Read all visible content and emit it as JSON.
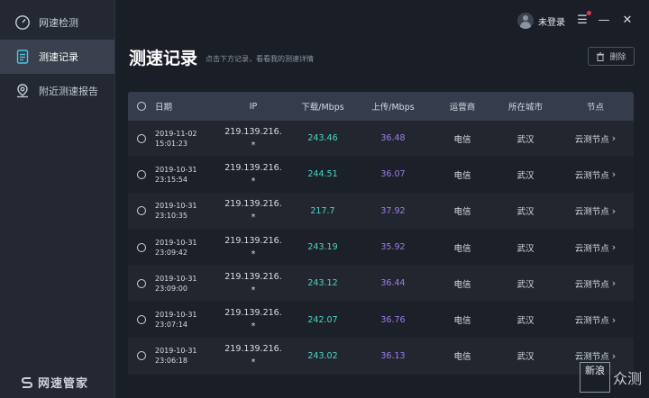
{
  "sidebar": {
    "items": [
      {
        "label": "网速检测",
        "icon": "speedometer-icon"
      },
      {
        "label": "测速记录",
        "icon": "document-list-icon"
      },
      {
        "label": "附近测速报告",
        "icon": "location-pin-icon"
      }
    ],
    "brand": "网速管家"
  },
  "topbar": {
    "user_label": "未登录"
  },
  "header": {
    "title": "测速记录",
    "subtitle": "点击下方记录，看看我的测速详情",
    "delete_label": "删除"
  },
  "table": {
    "columns": [
      "日期",
      "IP",
      "下载/Mbps",
      "上传/Mbps",
      "运营商",
      "所在城市",
      "节点"
    ],
    "rows": [
      {
        "date": "2019-11-02",
        "time": "15:01:23",
        "ip1": "219.139.216.",
        "ip2": "*",
        "down": "243.46",
        "up": "36.48",
        "isp": "电信",
        "city": "武汉",
        "node": "云测节点"
      },
      {
        "date": "2019-10-31",
        "time": "23:15:54",
        "ip1": "219.139.216.",
        "ip2": "*",
        "down": "244.51",
        "up": "36.07",
        "isp": "电信",
        "city": "武汉",
        "node": "云测节点"
      },
      {
        "date": "2019-10-31",
        "time": "23:10:35",
        "ip1": "219.139.216.",
        "ip2": "*",
        "down": "217.7",
        "up": "37.92",
        "isp": "电信",
        "city": "武汉",
        "node": "云测节点"
      },
      {
        "date": "2019-10-31",
        "time": "23:09:42",
        "ip1": "219.139.216.",
        "ip2": "*",
        "down": "243.19",
        "up": "35.92",
        "isp": "电信",
        "city": "武汉",
        "node": "云测节点"
      },
      {
        "date": "2019-10-31",
        "time": "23:09:00",
        "ip1": "219.139.216.",
        "ip2": "*",
        "down": "243.12",
        "up": "36.44",
        "isp": "电信",
        "city": "武汉",
        "node": "云测节点"
      },
      {
        "date": "2019-10-31",
        "time": "23:07:14",
        "ip1": "219.139.216.",
        "ip2": "*",
        "down": "242.07",
        "up": "36.76",
        "isp": "电信",
        "city": "武汉",
        "node": "云测节点"
      },
      {
        "date": "2019-10-31",
        "time": "23:06:18",
        "ip1": "219.139.216.",
        "ip2": "*",
        "down": "243.02",
        "up": "36.13",
        "isp": "电信",
        "city": "武汉",
        "node": "云测节点"
      }
    ]
  },
  "watermark": {
    "box": "新浪",
    "text": "众测"
  },
  "colors": {
    "download": "#4cd6c4",
    "upload": "#9f7cf2",
    "active_nav": "#3a404d",
    "notify_dot": "#e0384a"
  }
}
